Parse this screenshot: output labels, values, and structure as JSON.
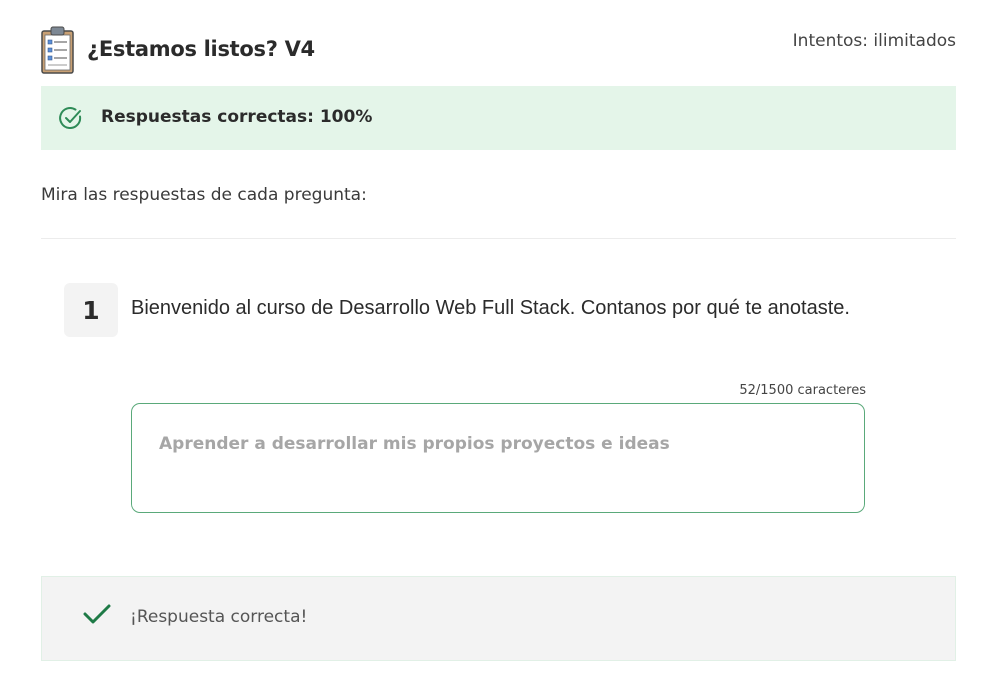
{
  "header": {
    "icon": "clipboard-checklist-icon",
    "title": "¿Estamos listos? V4",
    "attempts": "Intentos: ilimitados"
  },
  "score": {
    "icon": "circle-check-icon",
    "text": "Respuestas correctas: 100%",
    "accent_color": "#2e8b57"
  },
  "instructions": "Mira las respuestas de cada pregunta:",
  "question": {
    "number": "1",
    "text": "Bienvenido al curso de Desarrollo Web Full Stack. Contanos por qué te anotaste.",
    "char_count": "52/1500 caracteres",
    "answer": "Aprender a desarrollar mis propios proyectos e ideas"
  },
  "feedback": {
    "icon": "checkmark-icon",
    "text": "¡Respuesta correcta!",
    "check_color": "#1e7a46"
  }
}
